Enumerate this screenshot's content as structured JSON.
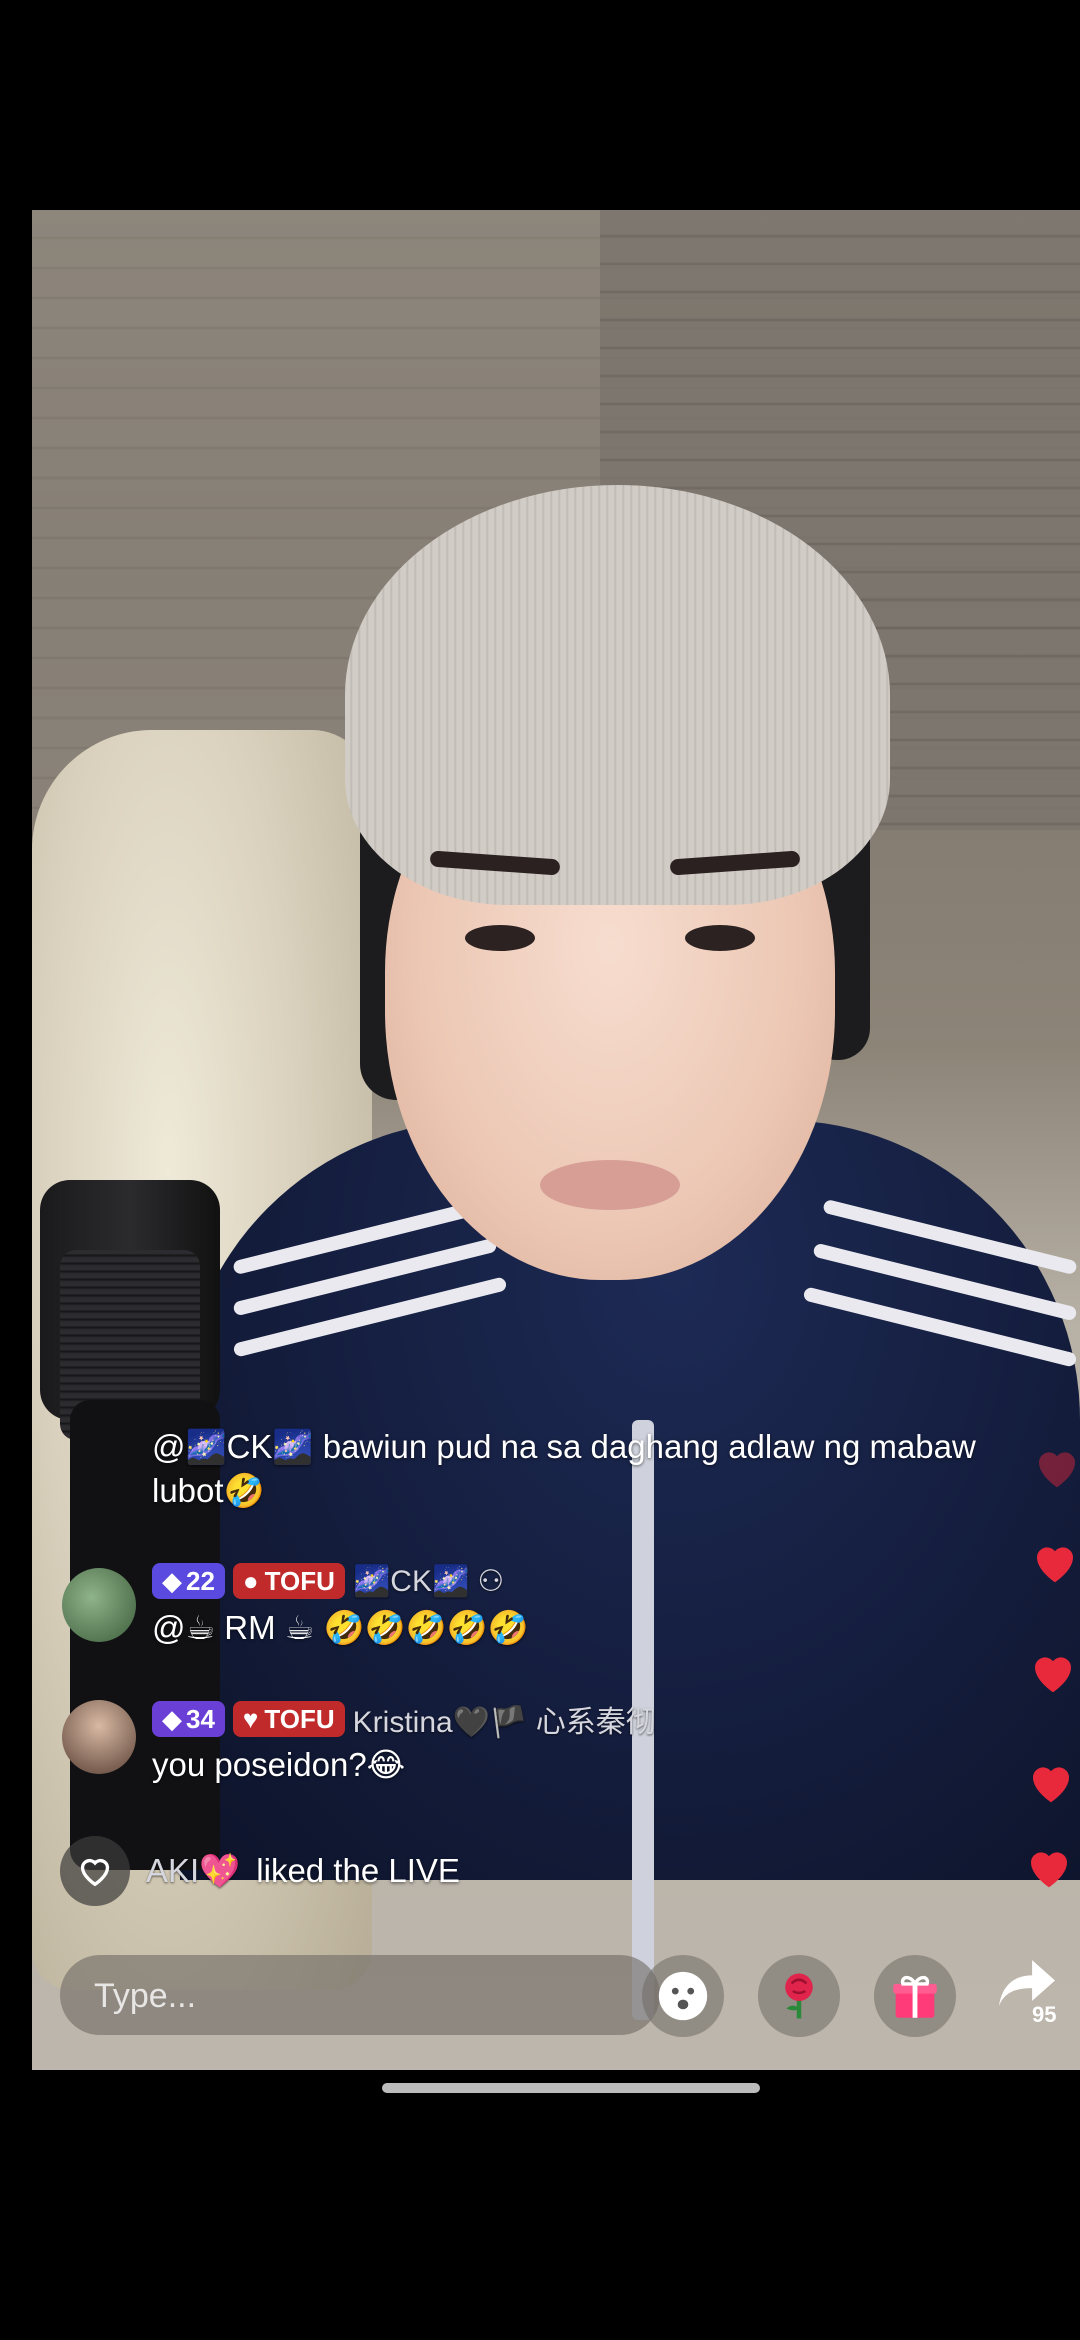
{
  "comments": [
    {
      "partial_top": true,
      "user": "CK",
      "text_line1": "@🌌CK🌌 bawiun pud na sa daghang adlaw ng mabaw",
      "text_line2": "lubot🤣"
    },
    {
      "level": "22",
      "badge": "TOFU",
      "user": "🌌CK🌌",
      "text": "@☕ RM ☕ 🤣🤣🤣🤣🤣"
    },
    {
      "level": "34",
      "badge": "TOFU",
      "user": "Kristina🖤🏴 心系秦彻",
      "text": "you poseidon?😂"
    }
  ],
  "like_event": {
    "user": "AKI💖",
    "text": "liked the LIVE"
  },
  "input": {
    "placeholder": "Type..."
  },
  "share": {
    "count": "95"
  },
  "icons": {
    "heart_color": "#e8293b",
    "gift_color": "#ff3b7a"
  }
}
